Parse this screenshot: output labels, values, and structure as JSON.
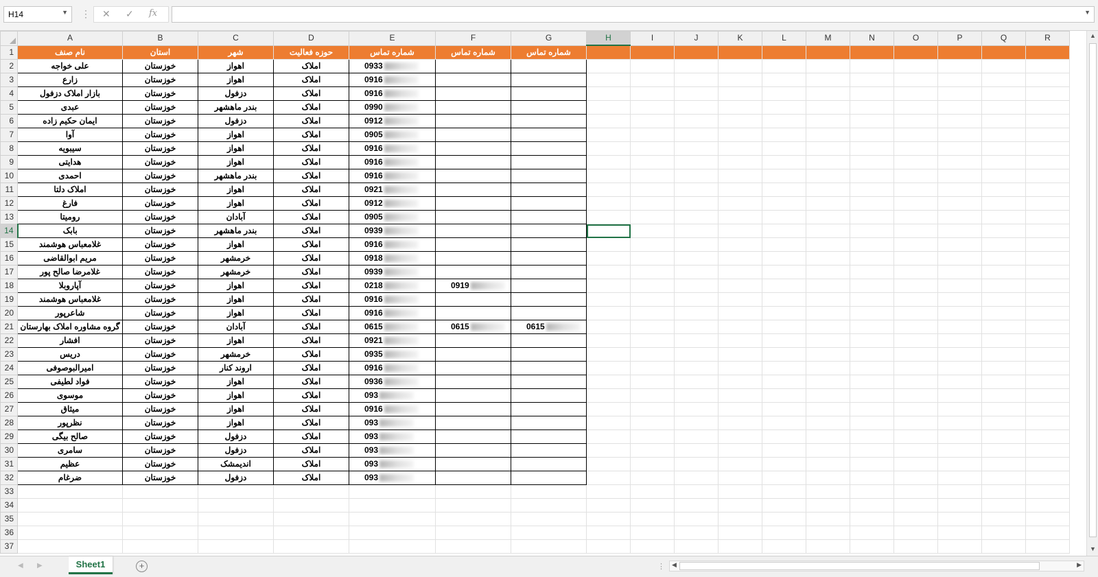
{
  "formula_bar": {
    "name_box": "H14",
    "cancel_icon": "✕",
    "enter_icon": "✓",
    "function_icon": "fx",
    "formula_value": ""
  },
  "columns": [
    "A",
    "B",
    "C",
    "D",
    "E",
    "F",
    "G",
    "H",
    "I",
    "J",
    "K",
    "L",
    "M",
    "N",
    "O",
    "P",
    "Q",
    "R"
  ],
  "selected_cell": {
    "column": "H",
    "row": 14
  },
  "header_row": {
    "row": 1,
    "cells": [
      "نام صنف",
      "استان",
      "شهر",
      "حوزه فعالیت",
      "شماره تماس",
      "شماره تماس",
      "شماره تماس"
    ]
  },
  "rows": [
    {
      "n": 2,
      "A": "علی خواجه",
      "B": "خوزستان",
      "C": "اهواز",
      "D": "املاک",
      "E": "0933",
      "F": "",
      "G": ""
    },
    {
      "n": 3,
      "A": "زارع",
      "B": "خوزستان",
      "C": "اهواز",
      "D": "املاک",
      "E": "0916",
      "F": "",
      "G": ""
    },
    {
      "n": 4,
      "A": "بازار املاک دزفول",
      "B": "خوزستان",
      "C": "دزفول",
      "D": "املاک",
      "E": "0916",
      "F": "",
      "G": ""
    },
    {
      "n": 5,
      "A": "عبدی",
      "B": "خوزستان",
      "C": "بندر ماهشهر",
      "D": "املاک",
      "E": "0990",
      "F": "",
      "G": ""
    },
    {
      "n": 6,
      "A": "ایمان حکیم زاده",
      "B": "خوزستان",
      "C": "دزفول",
      "D": "املاک",
      "E": "0912",
      "F": "",
      "G": ""
    },
    {
      "n": 7,
      "A": "آوا",
      "B": "خوزستان",
      "C": "اهواز",
      "D": "املاک",
      "E": "0905",
      "F": "",
      "G": ""
    },
    {
      "n": 8,
      "A": "سیبویه",
      "B": "خوزستان",
      "C": "اهواز",
      "D": "املاک",
      "E": "0916",
      "F": "",
      "G": ""
    },
    {
      "n": 9,
      "A": "هدایتی",
      "B": "خوزستان",
      "C": "اهواز",
      "D": "املاک",
      "E": "0916",
      "F": "",
      "G": ""
    },
    {
      "n": 10,
      "A": "احمدی",
      "B": "خوزستان",
      "C": "بندر ماهشهر",
      "D": "املاک",
      "E": "0916",
      "F": "",
      "G": ""
    },
    {
      "n": 11,
      "A": "املاک دلتا",
      "B": "خوزستان",
      "C": "اهواز",
      "D": "املاک",
      "E": "0921",
      "F": "",
      "G": ""
    },
    {
      "n": 12,
      "A": "فارغ",
      "B": "خوزستان",
      "C": "اهواز",
      "D": "املاک",
      "E": "0912",
      "F": "",
      "G": ""
    },
    {
      "n": 13,
      "A": "رومیتا",
      "B": "خوزستان",
      "C": "آبادان",
      "D": "املاک",
      "E": "0905",
      "F": "",
      "G": ""
    },
    {
      "n": 14,
      "A": "بابک",
      "B": "خوزستان",
      "C": "بندر ماهشهر",
      "D": "املاک",
      "E": "0939",
      "F": "",
      "G": ""
    },
    {
      "n": 15,
      "A": "غلامعباس هوشمند",
      "B": "خوزستان",
      "C": "اهواز",
      "D": "املاک",
      "E": "0916",
      "F": "",
      "G": ""
    },
    {
      "n": 16,
      "A": "مریم ابوالقاضی",
      "B": "خوزستان",
      "C": "خرمشهر",
      "D": "املاک",
      "E": "0918",
      "F": "",
      "G": ""
    },
    {
      "n": 17,
      "A": "غلامرضا صالح پور",
      "B": "خوزستان",
      "C": "خرمشهر",
      "D": "املاک",
      "E": "0939",
      "F": "",
      "G": ""
    },
    {
      "n": 18,
      "A": "آپاروبلا",
      "B": "خوزستان",
      "C": "اهواز",
      "D": "املاک",
      "E": "0218",
      "F": "0919",
      "G": ""
    },
    {
      "n": 19,
      "A": "غلامعباس هوشمند",
      "B": "خوزستان",
      "C": "اهواز",
      "D": "املاک",
      "E": "0916",
      "F": "",
      "G": ""
    },
    {
      "n": 20,
      "A": "شاعرپور",
      "B": "خوزستان",
      "C": "اهواز",
      "D": "املاک",
      "E": "0916",
      "F": "",
      "G": ""
    },
    {
      "n": 21,
      "A": "گروه مشاوره املاک بهارستان",
      "B": "خوزستان",
      "C": "آبادان",
      "D": "املاک",
      "E": "0615",
      "F": "0615",
      "G": "0615"
    },
    {
      "n": 22,
      "A": "افشار",
      "B": "خوزستان",
      "C": "اهواز",
      "D": "املاک",
      "E": "0921",
      "F": "",
      "G": ""
    },
    {
      "n": 23,
      "A": "دریس",
      "B": "خوزستان",
      "C": "خرمشهر",
      "D": "املاک",
      "E": "0935",
      "F": "",
      "G": ""
    },
    {
      "n": 24,
      "A": "امیرالبوصوفی",
      "B": "خوزستان",
      "C": "اروند کنار",
      "D": "املاک",
      "E": "0916",
      "F": "",
      "G": ""
    },
    {
      "n": 25,
      "A": "فواد لطیفی",
      "B": "خوزستان",
      "C": "اهواز",
      "D": "املاک",
      "E": "0936",
      "F": "",
      "G": ""
    },
    {
      "n": 26,
      "A": "موسوی",
      "B": "خوزستان",
      "C": "اهواز",
      "D": "املاک",
      "E": "093",
      "F": "",
      "G": ""
    },
    {
      "n": 27,
      "A": "میثاق",
      "B": "خوزستان",
      "C": "اهواز",
      "D": "املاک",
      "E": "0916",
      "F": "",
      "G": ""
    },
    {
      "n": 28,
      "A": "نظرپور",
      "B": "خوزستان",
      "C": "اهواز",
      "D": "املاک",
      "E": "093",
      "F": "",
      "G": ""
    },
    {
      "n": 29,
      "A": "صالح بیگی",
      "B": "خوزستان",
      "C": "دزفول",
      "D": "املاک",
      "E": "093",
      "F": "",
      "G": ""
    },
    {
      "n": 30,
      "A": "سامری",
      "B": "خوزستان",
      "C": "دزفول",
      "D": "املاک",
      "E": "093",
      "F": "",
      "G": ""
    },
    {
      "n": 31,
      "A": "عظیم",
      "B": "خوزستان",
      "C": "اندیمشک",
      "D": "املاک",
      "E": "093",
      "F": "",
      "G": ""
    },
    {
      "n": 32,
      "A": "ضرغام",
      "B": "خوزستان",
      "C": "دزفول",
      "D": "املاک",
      "E": "093",
      "F": "",
      "G": ""
    }
  ],
  "empty_rows": [
    33,
    34,
    35,
    36,
    37
  ],
  "sheet_tabs": [
    "Sheet1"
  ],
  "colors": {
    "header_fill": "#ed7d31",
    "header_text": "#ffffff",
    "accent": "#217346"
  }
}
